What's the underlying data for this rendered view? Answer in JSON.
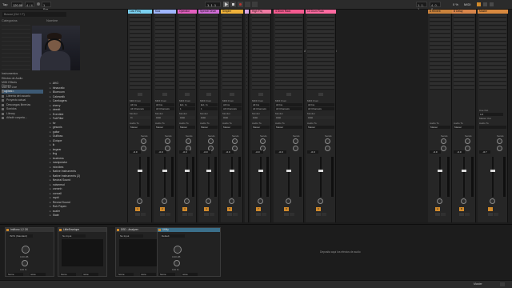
{
  "topbar": {
    "tap": "Tap",
    "tempo": "120.00",
    "signature": "4 / 4",
    "metronome": "1 Bar",
    "position": "1. 1. 1",
    "loop_start": "1. 1. 1",
    "loop_length": "4. 0. 0",
    "cpu": "0 %",
    "midi": "MIDI"
  },
  "browser": {
    "search_placeholder": "Buscar (Ctrl + F)",
    "column_header": "Nombre",
    "categories_title": "Categorías",
    "categories": [
      "Instrumentos",
      "Efectos de Audio",
      "MIDI Effects",
      "Max for Live",
      "Plug-Ins"
    ],
    "selected_category": "Plug-Ins",
    "places_title": "Places",
    "places": [
      "Packs",
      "Librería del usuario",
      "Proyecto actual",
      "Descargas librerías",
      "Sonidos",
      "Library",
      "Añadir carpeta…"
    ],
    "files": [
      "AKG",
      "binauralic",
      "Blueroom",
      "Cakewalk",
      "Camkagers",
      "cherry",
      "deeelt",
      "Eventide",
      "FabFilter",
      "fxr",
      "gesaxis",
      "guitar",
      "Gullfoss",
      "iZotope",
      "ik",
      "kegear",
      "ling",
      "loudness",
      "manipulator",
      "mixvibes",
      "Native Instruments",
      "Native Instruments (2)",
      "Neutral Sound",
      "noisemsd",
      "onnnnh",
      "oonxall",
      "rapid",
      "Reveal Sound",
      "Rob Papen",
      "scaler",
      "Slate"
    ]
  },
  "tracks": [
    {
      "name": "Low Freq",
      "color": "#7ad0f0",
      "input": "All Ins",
      "input_ch": "All Channels",
      "monitor": "In",
      "output": "Master",
      "send_out": "Low Freq",
      "volume": "-0.0",
      "number": "1"
    },
    {
      "name": "Kick",
      "color": "#9fb6ff",
      "input": "All Ins",
      "input_ch": "All Channels",
      "monitor": "Auto",
      "output": "Master",
      "send_out": "Low Freq",
      "volume": "-0.0",
      "number": "2"
    },
    {
      "name": "Operator",
      "color": "#e35fbf",
      "input": "Ext. In",
      "input_ch": "1",
      "monitor": "Auto",
      "output": "Master",
      "send_out": "Low Freq",
      "volume": "-0.0",
      "number": "3"
    },
    {
      "name": "Speech Drum",
      "color": "#d06dd6",
      "input": "Ext. In",
      "input_ch": "1",
      "monitor": "Auto",
      "output": "Master",
      "send_out": "Low Freq",
      "volume": "-0.0",
      "number": "4"
    },
    {
      "name": "Simpler",
      "color": "#f0b23a",
      "input": "All Ins",
      "input_ch": "All Channels",
      "monitor": "Auto",
      "output": "Master",
      "send_out": "Low Freq",
      "volume": "-0.0",
      "number": "5"
    },
    {
      "name": "",
      "color": "#d9a7e6",
      "input": "",
      "input_ch": "",
      "monitor": "",
      "output": "",
      "send_out": "",
      "volume": "-0.0",
      "number": "6"
    },
    {
      "name": "High Frq",
      "color": "#f07aa3",
      "input": "All Ins",
      "input_ch": "All Channels",
      "monitor": "Auto",
      "output": "Master",
      "send_out": "",
      "volume": "-0.0",
      "number": "7"
    },
    {
      "name": "4 Drum Rack",
      "color": "#f45a8f",
      "input": "All Ins",
      "input_ch": "All Channels",
      "monitor": "Auto",
      "output": "Master",
      "send_out": "",
      "volume": "-0.0",
      "number": "8"
    },
    {
      "name": "10 Drum Rack",
      "color": "#ff6aa0",
      "input": "All Ins",
      "input_ch": "All Channels",
      "monitor": "Auto",
      "output": "Master",
      "send_out": "",
      "volume": "-0.0",
      "number": "9"
    }
  ],
  "returns": [
    {
      "name": "A Reverb",
      "color": "#c9823c",
      "output": "Master",
      "volume": "-0.0",
      "letter": "A"
    },
    {
      "name": "B Delay",
      "color": "#d8854a",
      "output": "Master",
      "volume": "-0.0",
      "letter": "B"
    }
  ],
  "master": {
    "name": "Master",
    "color": "#d8893f",
    "cue_out": "1/2",
    "master_out": "1/2",
    "volume": "-6.7",
    "label_cue": "Cue Out",
    "label_master": "Master Out"
  },
  "session": {
    "drop_message": "Suelta Archivos y Dispositivos aquí",
    "audio_to": "Audio To",
    "midi_from": "MIDI From",
    "monitor": "Monitor",
    "sends": "Sends",
    "in_label": "In",
    "auto_label": "Auto",
    "off_label": "Off"
  },
  "devices": {
    "drop_message": "Deposita aquí los efectos de audio",
    "items": [
      {
        "title": "ImMono 1.2 CK",
        "preset": "INVS (Standard)",
        "knob_a": "home",
        "knob_b": "none"
      },
      {
        "title": "LittleEnvelope",
        "preset": "No Input",
        "knob_a": "home",
        "knob_b": "none"
      },
      {
        "title": "DSD - Analyzer",
        "preset": "No Input",
        "knob_a": "home",
        "knob_b": "none"
      },
      {
        "title": "Utility",
        "preset": "Default",
        "knob_a": "home",
        "knob_b": "none"
      }
    ],
    "gain_label": "0.00 dB",
    "width_label": "100 %"
  },
  "statusbar": {
    "right_label": "Master"
  }
}
